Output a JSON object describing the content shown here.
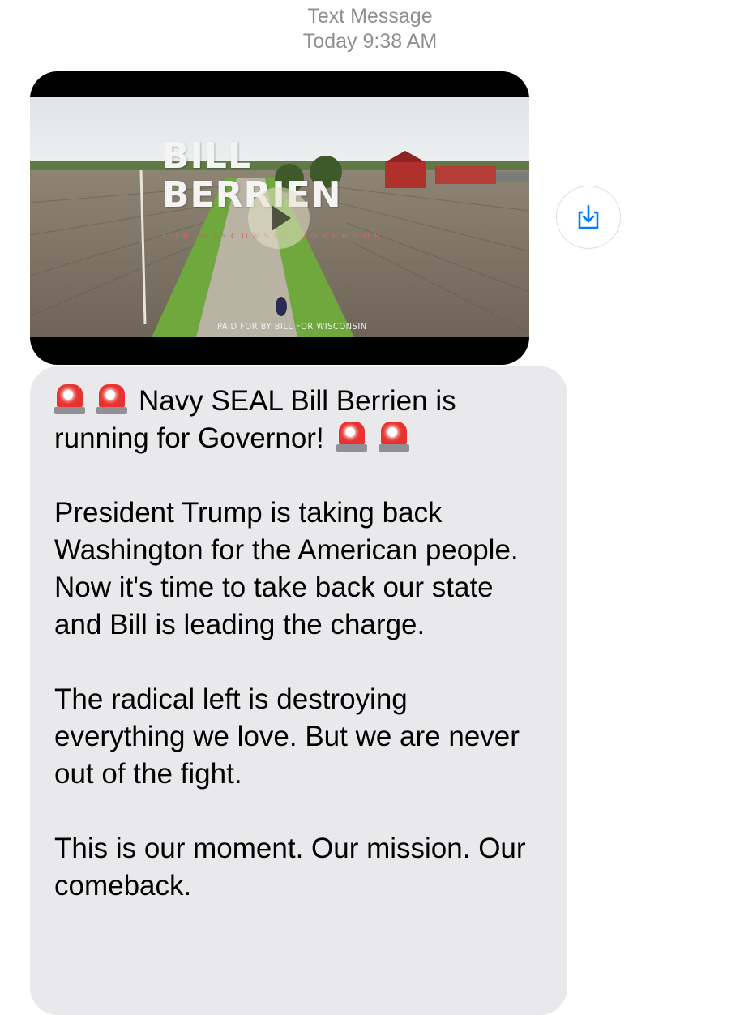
{
  "header": {
    "label": "Text Message",
    "time": "Today 9:38 AM"
  },
  "video": {
    "brand_line1": "BILL",
    "brand_line2": "BERRIEN",
    "brand_sub": "FOR WISCONSIN GOVERNOR",
    "disclaimer": "PAID FOR BY BILL FOR WISCONSIN"
  },
  "icons": {
    "play": "play-icon",
    "save": "download-icon",
    "siren": "police-car-light-emoji"
  },
  "message": {
    "line1_a": "Navy SEAL Bill Berrien is",
    "line1_b": "running for Governor!",
    "para2": "President Trump is taking back Washington for the American people. Now it's time to take back our state and Bill is leading the charge.",
    "para3": "The radical left is destroying everything we love. But we are never out of the fight.",
    "para4": "This is our moment. Our mission. Our comeback."
  },
  "colors": {
    "bubble": "#e9e9eb",
    "accent": "#007aff",
    "siren_red": "#e8322f"
  }
}
